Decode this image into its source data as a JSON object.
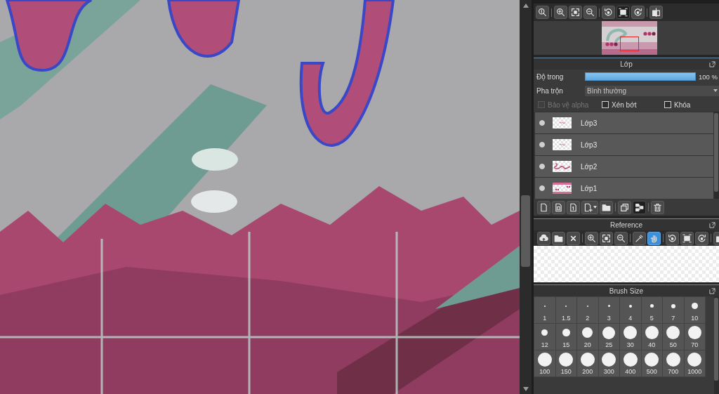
{
  "navigator": {
    "tools": [
      {
        "active": false
      },
      {
        "active": false
      },
      {
        "active": false
      },
      {
        "active": false
      },
      {
        "active": false
      },
      {
        "active": true
      },
      {
        "active": false
      },
      {
        "active": false
      }
    ]
  },
  "layers_panel": {
    "title": "Lớp",
    "opacity": {
      "label": "Độ trong",
      "level": 1,
      "reading": "100 %"
    },
    "blend_mode": {
      "label": "Pha trộn",
      "value": "Bình thường"
    },
    "options": [
      {
        "label": "Bảo vệ alpha",
        "checked": false,
        "disabled": true
      },
      {
        "label": "Xén bớt",
        "checked": false,
        "disabled": false
      },
      {
        "label": "Khóa",
        "checked": false,
        "disabled": false
      }
    ],
    "layers": [
      {
        "name": "Lớp3",
        "visible": true,
        "selected": false
      },
      {
        "name": "Lớp3",
        "visible": true,
        "selected": false
      },
      {
        "name": "Lớp2",
        "visible": true,
        "selected": false
      },
      {
        "name": "Lớp1",
        "visible": true,
        "selected": false
      }
    ],
    "tools": [
      {
        "active": false
      },
      {
        "active": false
      },
      {
        "active": false
      },
      {
        "active": false
      },
      {
        "active": false
      },
      {
        "active": false
      },
      {
        "active": true
      },
      {
        "active": false
      }
    ]
  },
  "reference_panel": {
    "title": "Reference",
    "tools": [
      {
        "active": false
      },
      {
        "active": false
      },
      {
        "active": false
      },
      {
        "active": false
      },
      {
        "active": false
      },
      {
        "active": false
      },
      {
        "active": false
      },
      {
        "active": true
      },
      {
        "active": false
      },
      {
        "active": false
      },
      {
        "active": false
      },
      {
        "active": false
      }
    ]
  },
  "brush_size_panel": {
    "title": "Brush Size",
    "sizes": [
      {
        "label": "1",
        "selected": false
      },
      {
        "label": "1.5",
        "selected": false
      },
      {
        "label": "2",
        "selected": false
      },
      {
        "label": "3",
        "selected": false
      },
      {
        "label": "4",
        "selected": false
      },
      {
        "label": "5",
        "selected": false
      },
      {
        "label": "7",
        "selected": false
      },
      {
        "label": "10",
        "selected": false
      },
      {
        "label": "12",
        "selected": false
      },
      {
        "label": "15",
        "selected": false
      },
      {
        "label": "20",
        "selected": false
      },
      {
        "label": "25",
        "selected": false
      },
      {
        "label": "30",
        "selected": false
      },
      {
        "label": "40",
        "selected": false
      },
      {
        "label": "50",
        "selected": false
      },
      {
        "label": "70",
        "selected": false
      },
      {
        "label": "100",
        "selected": false
      },
      {
        "label": "150",
        "selected": false
      },
      {
        "label": "200",
        "selected": false
      },
      {
        "label": "300",
        "selected": false
      },
      {
        "label": "400",
        "selected": false
      },
      {
        "label": "500",
        "selected": false
      },
      {
        "label": "700",
        "selected": false
      },
      {
        "label": "1000",
        "selected": false
      }
    ]
  }
}
